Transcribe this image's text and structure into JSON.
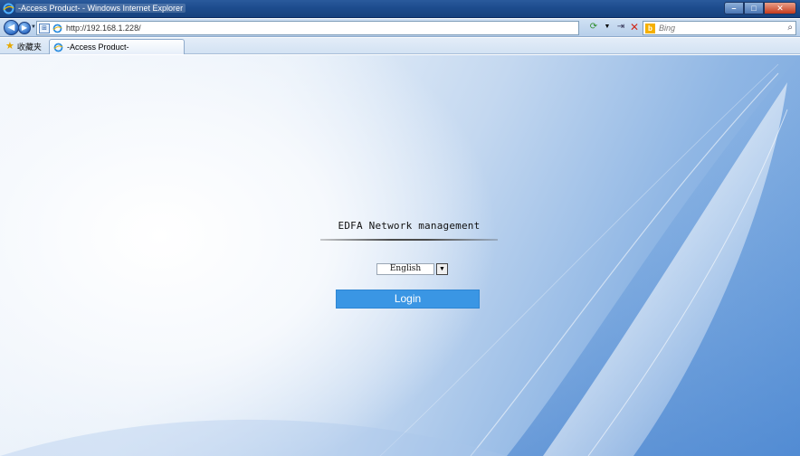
{
  "window": {
    "title": "-Access Product- - Windows Internet Explorer",
    "controls": {
      "minimize": "–",
      "maximize": "□",
      "close": "✕"
    }
  },
  "address_bar": {
    "url": "http://192.168.1.228/",
    "search_placeholder": "Bing"
  },
  "favorites": {
    "label": "收藏夹"
  },
  "tabs": [
    {
      "label": "-Access Product-"
    }
  ],
  "login": {
    "heading": "EDFA Network management",
    "language": {
      "selected": "English"
    },
    "submit_label": "Login"
  },
  "colors": {
    "login_button": "#3a96e4",
    "titlebar": "#1d4c8e"
  }
}
